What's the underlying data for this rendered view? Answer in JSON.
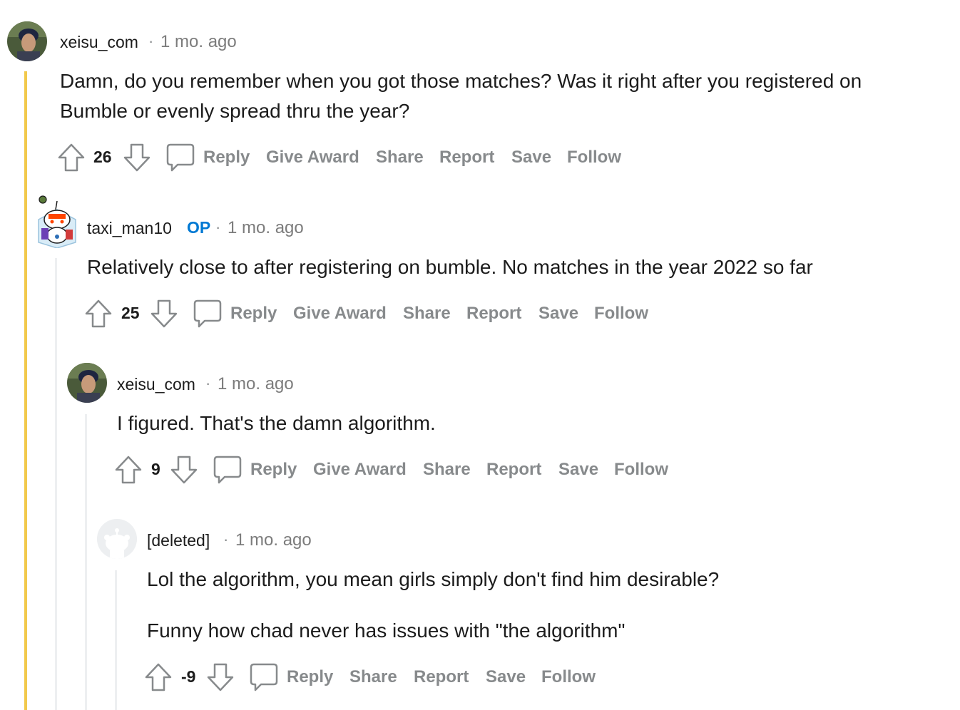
{
  "colors": {
    "accent_op": "#0079d3",
    "action_gray": "#878a8c",
    "thread_highlight": "#f2c94c",
    "thread_line": "#edeff1"
  },
  "separator": "·",
  "comments": [
    {
      "username": "xeisu_com",
      "time": "1 mo. ago",
      "body": [
        "Damn, do you remember when you got those matches? Was it right after you registered on",
        "Bumble or evenly spread thru the year?"
      ],
      "score": "26",
      "actions": [
        "Reply",
        "Give Award",
        "Share",
        "Report",
        "Save",
        "Follow"
      ],
      "avatar_icon": "user-photo-avatar"
    },
    {
      "username": "taxi_man10",
      "flair": "OP",
      "time": "1 mo. ago",
      "body": [
        "Relatively close to after registering on bumble. No matches in the year 2022 so far"
      ],
      "score": "25",
      "actions": [
        "Reply",
        "Give Award",
        "Share",
        "Report",
        "Save",
        "Follow"
      ],
      "avatar_icon": "snoo-avatar"
    },
    {
      "username": "xeisu_com",
      "time": "1 mo. ago",
      "body": [
        "I figured. That's the damn algorithm."
      ],
      "score": "9",
      "actions": [
        "Reply",
        "Give Award",
        "Share",
        "Report",
        "Save",
        "Follow"
      ],
      "avatar_icon": "user-photo-avatar"
    },
    {
      "username": "[deleted]",
      "time": "1 mo. ago",
      "body": [
        "Lol the algorithm, you mean girls simply don't find him desirable?",
        "Funny how chad never has issues with \"the algorithm\""
      ],
      "score": "-9",
      "actions": [
        "Reply",
        "Share",
        "Report",
        "Save",
        "Follow"
      ],
      "avatar_icon": "deleted-user-avatar"
    }
  ]
}
